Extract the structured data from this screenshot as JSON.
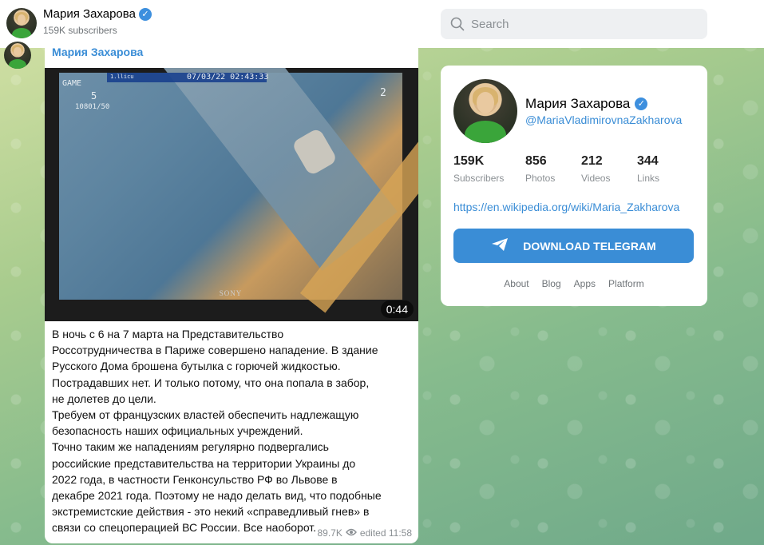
{
  "header": {
    "channel_name": "Мария Захарова",
    "subscribers": "159K subscribers",
    "search_placeholder": "Search"
  },
  "message": {
    "author": "Мария Захарова",
    "video": {
      "osd_game": "GAME",
      "osd_timestamp": "07/03/22 02:43:33",
      "osd_small": "1.llicu",
      "osd_count": "5",
      "osd_res": "10801/50",
      "osd_channel": "2",
      "brand": "SONY",
      "duration": "0:44"
    },
    "text": "В ночь с 6 на 7 марта на Представительство\nРоссотрудничества в Париже совершено нападение. В здание\nРусского Дома брошена бутылка с горючей жидкостью.\nПострадавших нет. И только потому, что она попала в забор,\nне долетев до цели.\nТребуем от французских властей обеспечить надлежащую\nбезопасность наших официальных учреждений.\nТочно таким же нападениям регулярно подвергались\nроссийские представительства на территории Украины до\n2022 года, в частности Генконсульство РФ во Львове в\nдекабре 2021 года. Поэтому не надо делать вид, что подобные\nэкстремистские действия - это некий «справедливый гнев» в\nсвязи со спецоперацией ВС России. Все наоборот.",
    "views": "89.7K",
    "edited": "edited 11:58"
  },
  "profile": {
    "name": "Мария Захарова",
    "handle": "@MariaVladimirovnaZakharova",
    "stats": [
      {
        "value": "159K",
        "label": "Subscribers"
      },
      {
        "value": "856",
        "label": "Photos"
      },
      {
        "value": "212",
        "label": "Videos"
      },
      {
        "value": "344",
        "label": "Links"
      }
    ],
    "link": "https://en.wikipedia.org/wiki/Maria_Zakharova",
    "download_label": "DOWNLOAD TELEGRAM",
    "footer_links": [
      "About",
      "Blog",
      "Apps",
      "Platform"
    ]
  },
  "colors": {
    "accent": "#3a8dd6",
    "verified": "#3d8fde",
    "background_green": "#86bb8d"
  },
  "icons": {
    "search": "search-icon",
    "verified": "verified-badge-icon",
    "views": "eye-icon",
    "telegram": "telegram-plane-icon"
  }
}
